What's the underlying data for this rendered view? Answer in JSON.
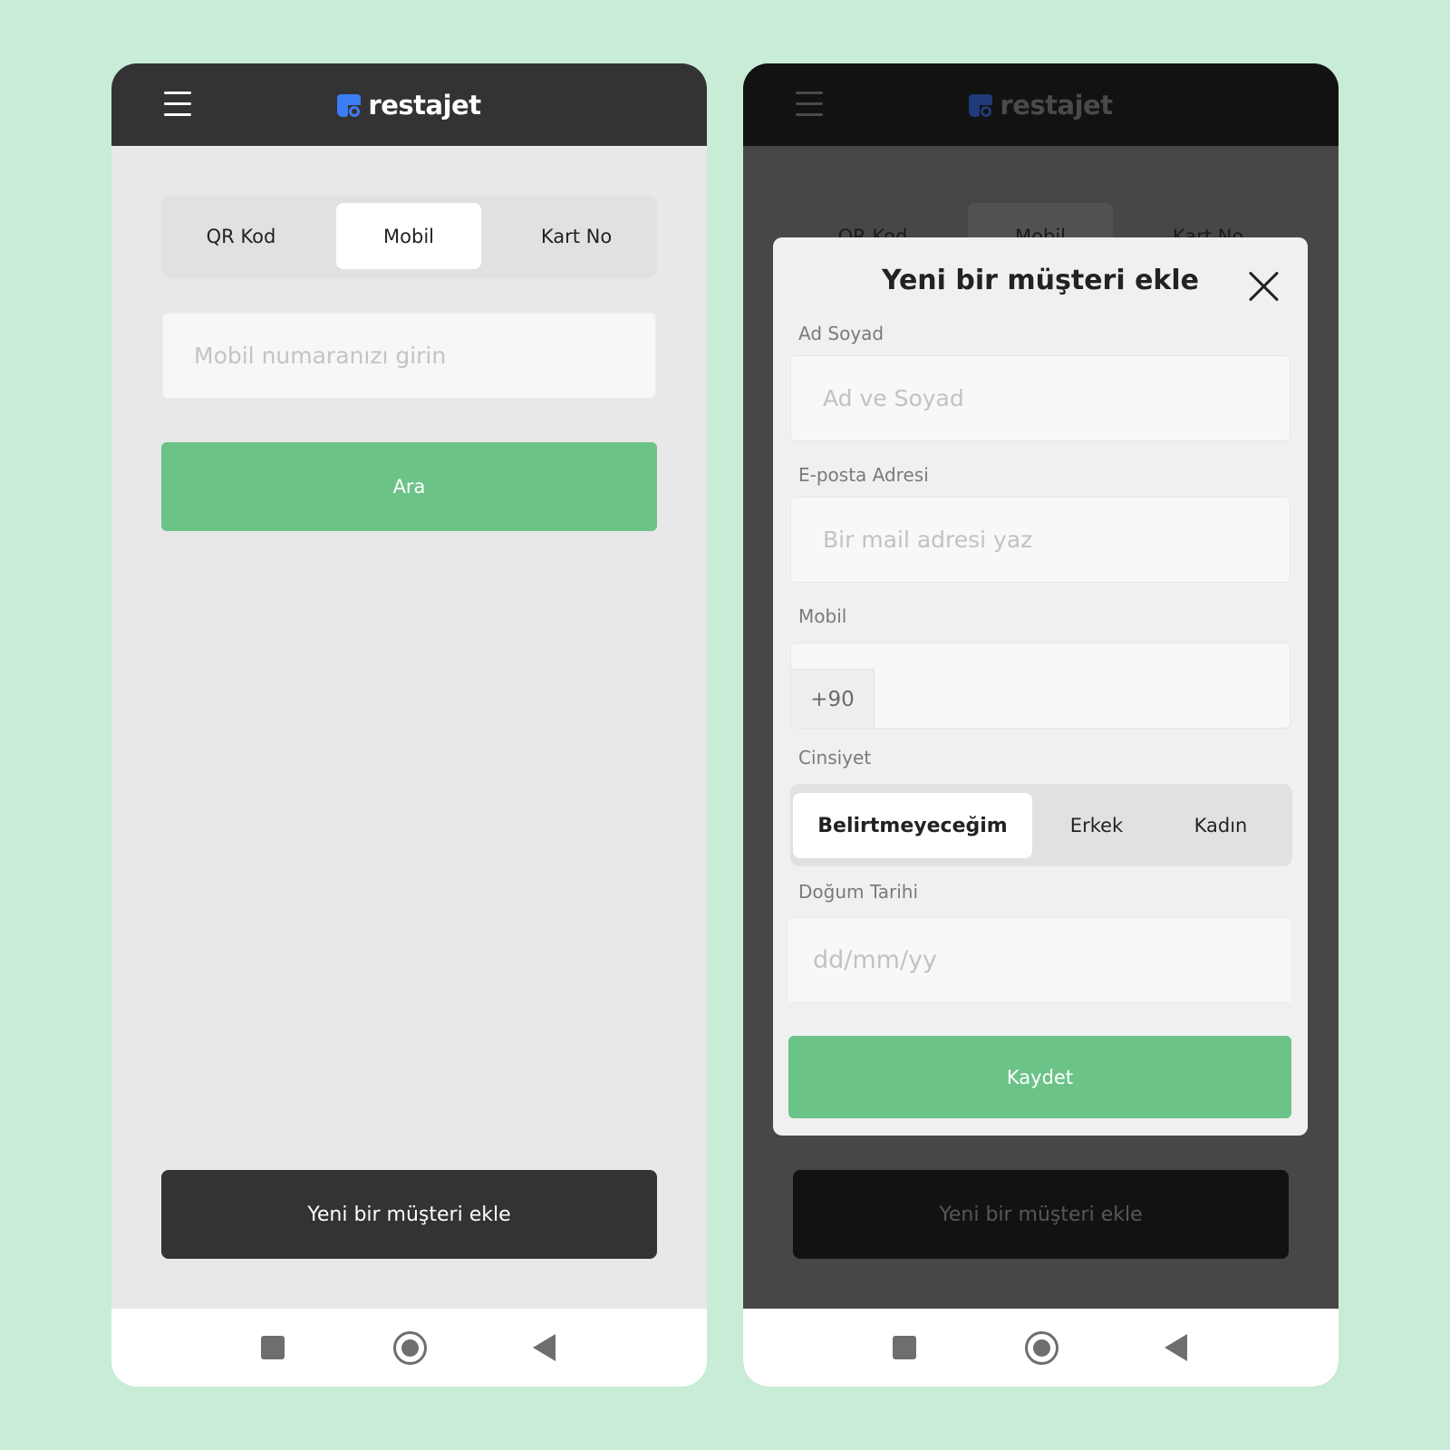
{
  "brand": {
    "name": "restajet",
    "accent": "#3b7df5",
    "success": "#6cc388"
  },
  "search_screen": {
    "tabs": [
      "QR Kod",
      "Mobil",
      "Kart No"
    ],
    "active_tab": "Mobil",
    "mobile_input_placeholder": "Mobil numaranızı girin",
    "search_button": "Ara",
    "add_customer_button": "Yeni bir müşteri ekle"
  },
  "add_customer_modal": {
    "title": "Yeni bir müşteri ekle",
    "fields": {
      "name": {
        "label": "Ad Soyad",
        "placeholder": "Ad ve Soyad"
      },
      "email": {
        "label": "E-posta Adresi",
        "placeholder": "Bir mail adresi yaz"
      },
      "mobile": {
        "label": "Mobil",
        "country_code": "+90",
        "value": ""
      },
      "gender": {
        "label": "Cinsiyet",
        "options": [
          "Belirtmeyeceğim",
          "Erkek",
          "Kadın"
        ],
        "selected": "Belirtmeyeceğim"
      },
      "birth_date": {
        "label": "Doğum Tarihi",
        "placeholder": "dd/mm/yy"
      }
    },
    "save_button": "Kaydet"
  },
  "icons": {
    "menu": "hamburger-menu-icon",
    "close": "close-icon",
    "nav_recents": "square-icon",
    "nav_home": "circle-home-icon",
    "nav_back": "back-triangle-icon"
  }
}
